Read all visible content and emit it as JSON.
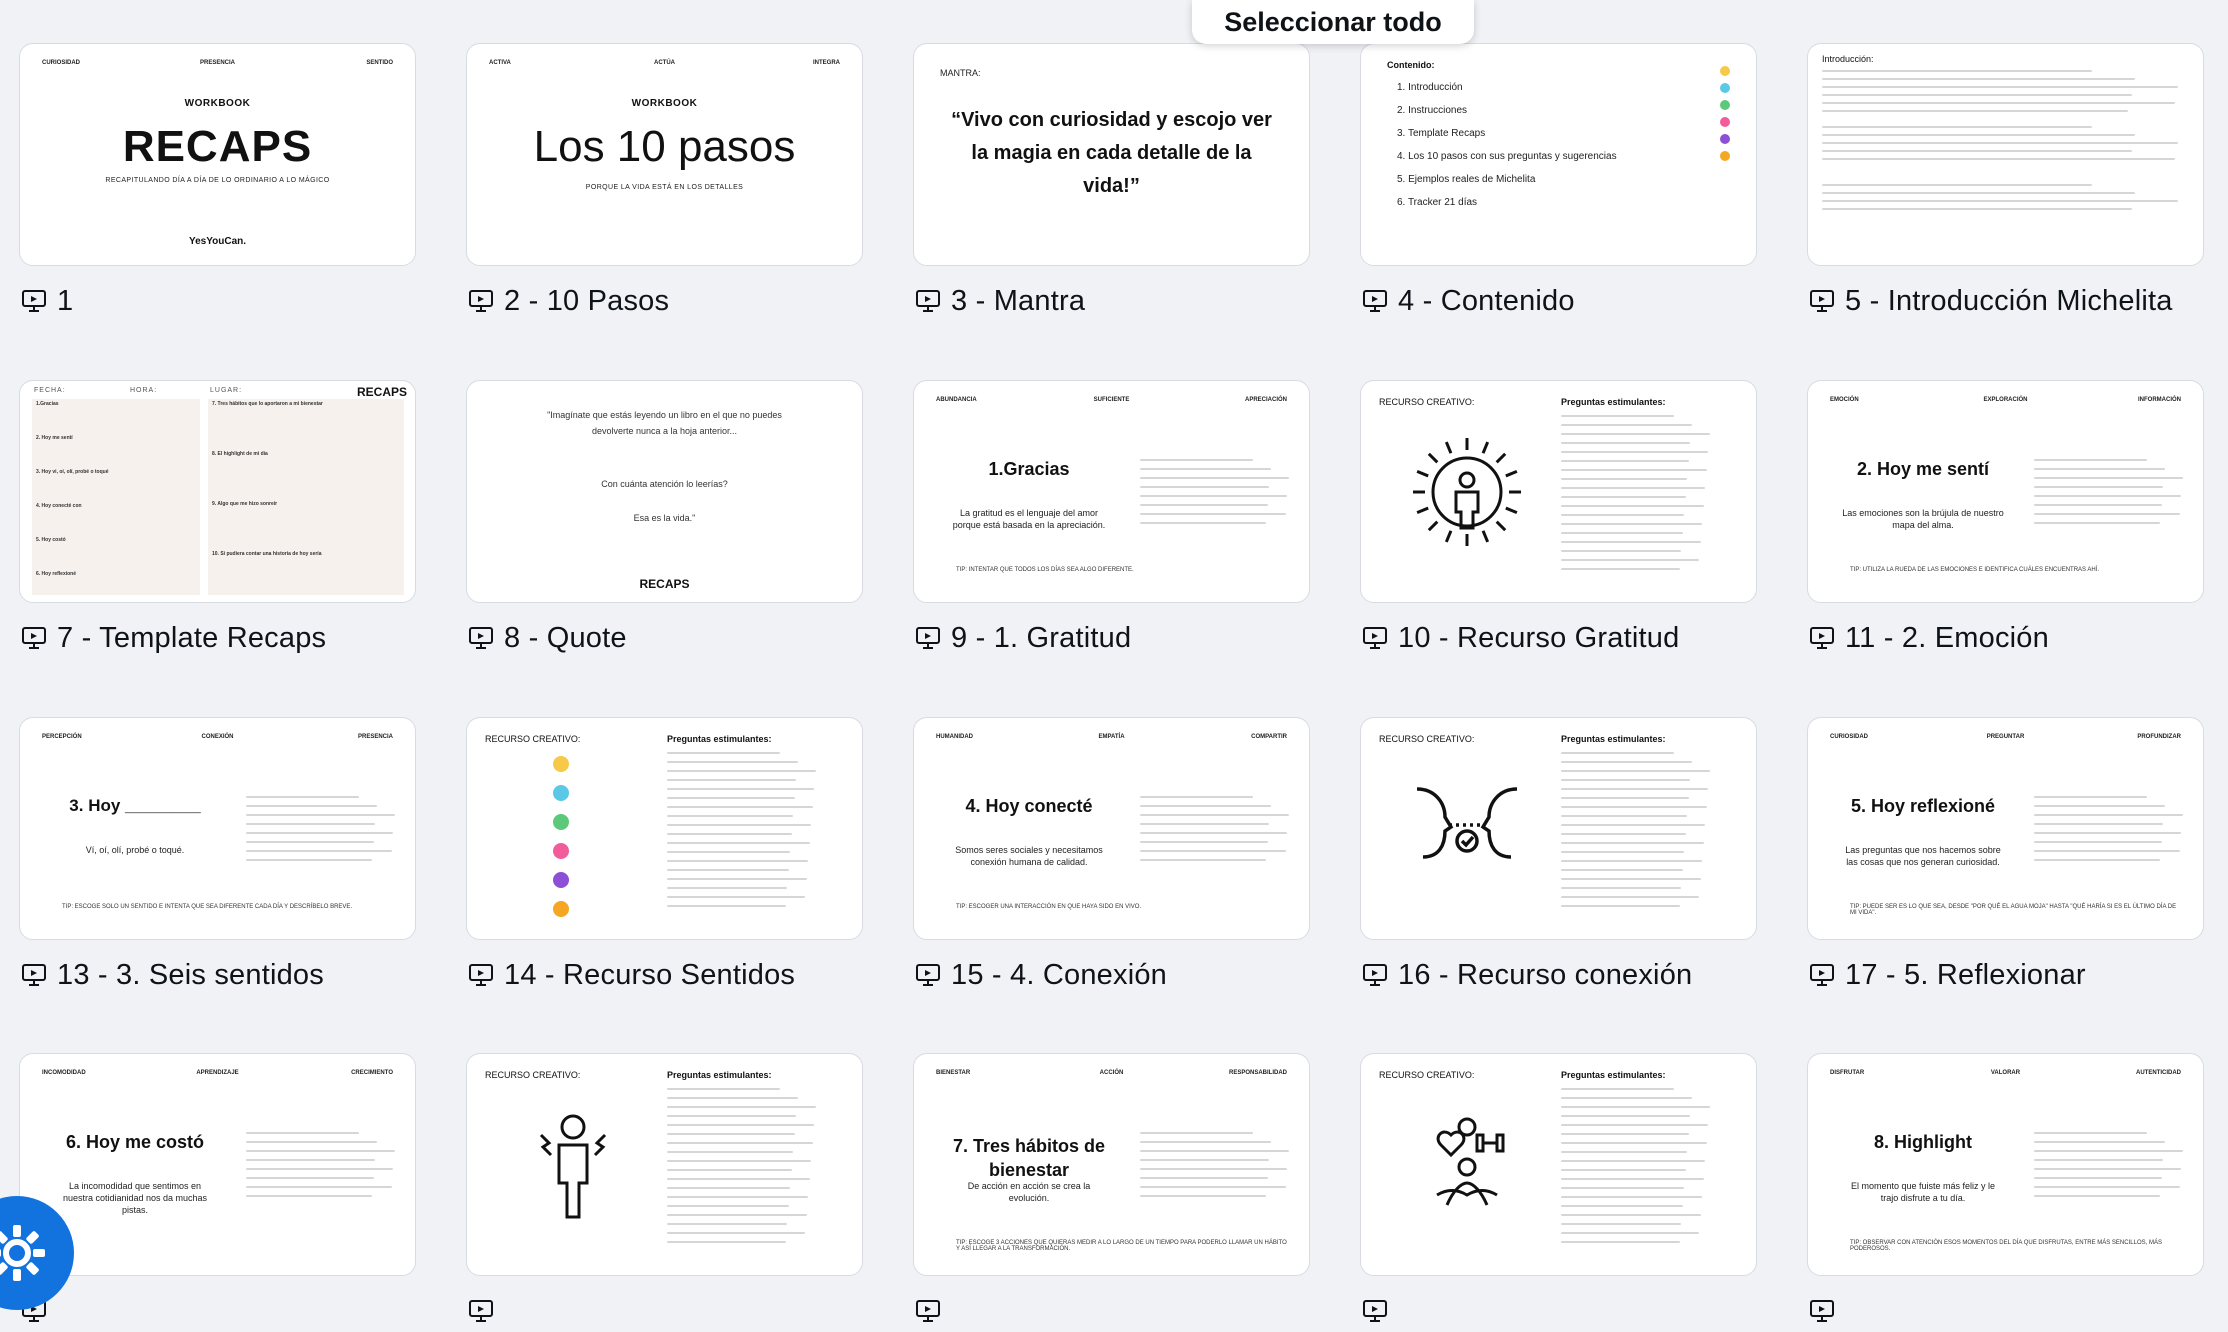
{
  "grid": {
    "select_all_label": "Seleccionar todo",
    "slides": [
      {
        "label": "1",
        "kind": "cover"
      },
      {
        "label": "2 - 10 Pasos",
        "kind": "pasos"
      },
      {
        "label": "3 - Mantra",
        "kind": "mantra"
      },
      {
        "label": "4 - Contenido",
        "kind": "contenido"
      },
      {
        "label": "5 - Introducción Michelita",
        "kind": "intro"
      },
      {
        "label": "7 - Template Recaps",
        "kind": "template"
      },
      {
        "label": "8 - Quote",
        "kind": "quote"
      },
      {
        "label": "9 - 1. Gratitud",
        "kind": "gratitud"
      },
      {
        "label": "10 -  Recurso Gratitud",
        "kind": "recurso",
        "icon": "sun-person"
      },
      {
        "label": "11 - 2. Emoción",
        "kind": "emocion"
      },
      {
        "label": "13 - 3. Seis sentidos",
        "kind": "sentidos"
      },
      {
        "label": "14 - Recurso Sentidos",
        "kind": "recurso-dots"
      },
      {
        "label": "15 - 4. Conexión",
        "kind": "conexion"
      },
      {
        "label": "16 - Recurso conexión",
        "kind": "recurso",
        "icon": "faces"
      },
      {
        "label": "17 - 5. Reflexionar",
        "kind": "reflexion"
      },
      {
        "label": "",
        "kind": "costo"
      },
      {
        "label": "",
        "kind": "recurso",
        "icon": "stressed"
      },
      {
        "label": "",
        "kind": "habitos"
      },
      {
        "label": "",
        "kind": "recurso",
        "icon": "wellness"
      },
      {
        "label": "",
        "kind": "highlight"
      }
    ]
  },
  "thumbs": {
    "cover": {
      "h1": "CURIOSIDAD",
      "h2": "PRESENCIA",
      "h3": "SENTIDO",
      "workbook": "WORKBOOK",
      "title": "RECAPS",
      "subtitle": "RECAPITULANDO DÍA A DÍA DE LO ORDINARIO A LO MÁGICO",
      "brand": "YesYouCan."
    },
    "pasos": {
      "h1": "ACTIVA",
      "h2": "ACTÚA",
      "h3": "INTEGRA",
      "workbook": "WORKBOOK",
      "title": "Los 10 pasos",
      "subtitle": "PORQUE LA VIDA ESTÁ EN LOS DETALLES"
    },
    "mantra": {
      "label": "MANTRA:",
      "text": "“Vivo con curiosidad y escojo ver la magia en cada detalle de la vida!”"
    },
    "contenido": {
      "label": "Contenido:",
      "items": [
        "1. Introducción",
        "2. Instrucciones",
        "3. Template Recaps",
        "4. Los 10 pasos con sus preguntas y sugerencias",
        "5. Ejemplos reales de Michelita",
        "6. Tracker 21 días"
      ]
    },
    "intro": {
      "label": "Introducción:"
    },
    "template": {
      "fecha": "FECHA:",
      "hora": "HORA:",
      "lugar": "LUGAR:",
      "brand": "RECAPS",
      "rows": [
        "1.Gracias",
        "2. Hoy me sentí",
        "3. Hoy vi, oí, olí, probé o toqué",
        "4. Hoy conecté con",
        "5. Hoy costó",
        "6. Hoy reflexioné"
      ],
      "right_rows": [
        "7. Tres hábitos que lo aportaron a mi bienestar",
        "8. El highlight de mi día",
        "9. Algo que me hizo sonreír",
        "10. Si pudiera contar una historia de hoy sería"
      ]
    },
    "quote": {
      "text": "\"Imagínate que estás leyendo un libro en el que no puedes devolverte nunca a la hoja anterior...",
      "text2": "Con cuánta atención lo leerías?",
      "text3": "Esa es la vida.\"",
      "brand": "RECAPS"
    },
    "gratitud": {
      "h1": "ABUNDANCIA",
      "h2": "SUFICIENTE",
      "h3": "APRECIACIÓN",
      "title": "1.Gracias",
      "body": "La gratitud es el lenguaje del amor porque está basada en la apreciación.",
      "tip": "TIP: INTENTAR QUE TODOS LOS DÍAS SEA ALGO DIFERENTE."
    },
    "recurso": {
      "label": "RECURSO CREATIVO:",
      "q": "Preguntas estimulantes:"
    },
    "emocion": {
      "h1": "EMOCIÓN",
      "h2": "EXPLORACIÓN",
      "h3": "INFORMACIÓN",
      "title": "2. Hoy me sentí",
      "body": "Las emociones son la brújula de nuestro mapa del alma.",
      "tip": "TIP: UTILIZA LA RUEDA DE LAS EMOCIONES E IDENTIFICA CUÁLES ENCUENTRAS AHÍ."
    },
    "sentidos": {
      "h1": "PERCEPCIÓN",
      "h2": "CONEXIÓN",
      "h3": "PRESENCIA",
      "title": "3. Hoy ________",
      "body": "Ví, oí, olí, probé o toqué.",
      "tip": "TIP: ESCOGE SOLO UN SENTIDO E INTENTA QUE SEA DIFERENTE CADA DÍA Y DESCRÍBELO BREVE."
    },
    "conexion": {
      "h1": "HUMANIDAD",
      "h2": "EMPATÍA",
      "h3": "COMPARTIR",
      "title": "4. Hoy conecté",
      "body": "Somos seres sociales y necesitamos conexión humana de calidad.",
      "tip": "TIP: ESCOGER UNA INTERACCIÓN EN QUE HAYA SIDO EN VIVO."
    },
    "reflexion": {
      "h1": "CURIOSIDAD",
      "h2": "PREGUNTAR",
      "h3": "PROFUNDIZAR",
      "title": "5. Hoy reflexioné",
      "body": "Las preguntas que nos hacemos sobre las cosas que nos generan curiosidad.",
      "tip": "TIP: PUEDE SER ES LO QUE SEA, DESDE \"POR QUÉ EL AGUA MOJA\" HASTA \"QUÉ HARÍA SI ES EL ÚLTIMO DÍA DE MI VIDA\"."
    },
    "costo": {
      "h1": "INCOMODIDAD",
      "h2": "APRENDIZAJE",
      "h3": "CRECIMIENTO",
      "title": "6. Hoy me costó",
      "body": "La incomodidad que sentimos en nuestra cotidianidad nos da muchas pistas."
    },
    "habitos": {
      "h1": "BIENESTAR",
      "h2": "ACCIÓN",
      "h3": "RESPONSABILIDAD",
      "title": "7. Tres hábitos de bienestar",
      "body": "De acción en acción se crea la evolución.",
      "tip": "TIP: ESCOGE 3 ACCIONES QUE QUIERAS MEDIR A LO LARGO DE UN TIEMPO PARA PODERLO LLAMAR UN HÁBITO Y ASÍ LLEGAR A LA TRANSFORMACIÓN."
    },
    "highlight": {
      "h1": "DISFRUTAR",
      "h2": "VALORAR",
      "h3": "AUTENTICIDAD",
      "title": "8. Highlight",
      "body": "El momento que fuiste más feliz y le trajo disfrute a tu día.",
      "tip": "TIP: OBSERVAR CON ATENCIÓN ESOS MOMENTOS DEL DÍA QUE DISFRUTAS, ENTRE MÁS SENCILLOS, MÁS PODEROSOS."
    }
  },
  "colors": {
    "accent": "#f5a623",
    "help": "#1273de",
    "dots": [
      "#f7c948",
      "#5ac8e6",
      "#5cc97a",
      "#f25c9a",
      "#8c4fd6",
      "#f5a623"
    ]
  }
}
